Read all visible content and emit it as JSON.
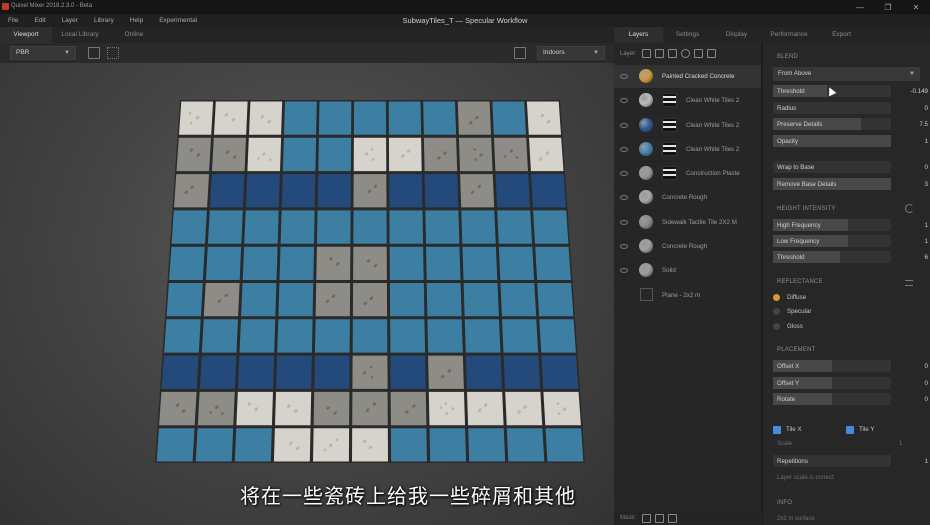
{
  "app": {
    "title": "Quixel Mixer 2018.2.3.0 - Beta",
    "document_title": "SubwayTiles_T — Specular Workflow"
  },
  "window_buttons": [
    "—",
    "❐",
    "✕"
  ],
  "menu": [
    "File",
    "Edit",
    "Layer",
    "Library",
    "Help",
    "Experimental"
  ],
  "viewport": {
    "tabs": [
      "Viewport",
      "Local Library",
      "Online"
    ],
    "active_tab": "Viewport",
    "render_mode": "PBR",
    "environment": "Indoors",
    "subtitle": "将在一些瓷砖上给我一些碎屑和其他"
  },
  "panel_tabs": [
    "Layers",
    "Settings",
    "Display",
    "Performance",
    "Export"
  ],
  "layers": {
    "header_label": "Layer:",
    "mask_label": "Mask:",
    "items": [
      {
        "name": "Painted Cracked Concrete",
        "thumb_color": "#d39a3a",
        "selected": true,
        "has_mask": false
      },
      {
        "name": "Clean White Tiles 2",
        "thumb_color": "#bcbcbc",
        "selected": false,
        "has_mask": true
      },
      {
        "name": "Clean White Tiles 2",
        "thumb_color": "#2d5e99",
        "selected": false,
        "has_mask": true
      },
      {
        "name": "Clean White Tiles 2",
        "thumb_color": "#3f86b3",
        "selected": false,
        "has_mask": true
      },
      {
        "name": "Construction Plaste",
        "thumb_color": "#9a9a9a",
        "selected": false,
        "has_mask": true
      },
      {
        "name": "Concrete Rough",
        "thumb_color": "#a8a8a8",
        "selected": false,
        "has_mask": false
      },
      {
        "name": "Sidewalk Tactile Tile 2X2 M",
        "thumb_color": "#8c8c8c",
        "selected": false,
        "has_mask": false
      },
      {
        "name": "Concrete Rough",
        "thumb_color": "#a0a0a0",
        "selected": false,
        "has_mask": false
      },
      {
        "name": "Solid",
        "thumb_color": "#9d9d9d",
        "selected": false,
        "has_mask": false
      },
      {
        "name": "Plane - 2x2 m",
        "thumb_color": "",
        "selected": false,
        "has_mask": false
      }
    ]
  },
  "properties": {
    "blend": {
      "title": "BLEND",
      "mode": "From Above",
      "threshold": {
        "label": "Threshold",
        "value": "-0.149"
      },
      "radius": {
        "label": "Radius",
        "value": "0"
      },
      "preserve_details": {
        "label": "Preserve Details",
        "value": "7.5"
      },
      "opacity": {
        "label": "Opacity",
        "value": "1"
      },
      "wrap_to_base": {
        "label": "Wrap to Base",
        "value": "0"
      },
      "remove_base_details": {
        "label": "Remove Base Details",
        "value": "3"
      }
    },
    "height_intensity": {
      "title": "HEIGHT INTENSITY",
      "high_frequency": {
        "label": "High Frequency",
        "value": "1"
      },
      "low_frequency": {
        "label": "Low Frequency",
        "value": "1"
      },
      "threshold": {
        "label": "Threshold",
        "value": "6"
      }
    },
    "reflectance": {
      "title": "REFLECTANCE",
      "options": [
        "Diffuse",
        "Specular",
        "Gloss"
      ],
      "selected": "Diffuse"
    },
    "placement": {
      "title": "PLACEMENT",
      "offset_x": {
        "label": "Offset X",
        "value": "0"
      },
      "offset_y": {
        "label": "Offset Y",
        "value": "0"
      },
      "rotate": {
        "label": "Rotate",
        "value": "0"
      },
      "tile_x": "Tile X",
      "tile_y": "Tile Y",
      "scale_label": "Scale",
      "scale_value": "1",
      "repetitions": {
        "label": "Repetitions",
        "value": "1"
      },
      "note": "Layer scale is correct."
    },
    "info": {
      "title": "INFO",
      "text": "2x2 m surface"
    }
  },
  "colors": {
    "accent_blue": "#3f8fdc",
    "diffuse_orange": "#d89a2e",
    "tile_blue": "#3d7ea3",
    "tile_navy": "#234a7a",
    "tile_white": "#d6d3cc",
    "concrete": "#8e8c86"
  },
  "tile_grid": [
    "WWWBBBBBCBW",
    "CCWBBWWCCCW",
    "CDDDDCDDCDD",
    "BBBBBBBBBBB",
    "BBBBCCBBBBB",
    "BCBBCCBBBBB",
    "BBBBBBBBBBB",
    "DDDDDCDCDDD",
    "CCWWCCCWWWW",
    "BBBWWWBBBBB"
  ]
}
